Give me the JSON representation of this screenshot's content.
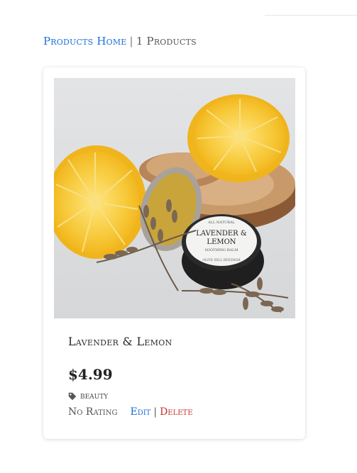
{
  "breadcrumb": {
    "home_link": "Products Home",
    "separator": "|",
    "count_text": "1 Products"
  },
  "product": {
    "image_label_line1": "LAVENDER &",
    "image_label_line2": "LEMON",
    "image_label_top": "ALL NATURAL",
    "image_label_sub": "SOOTHING BALM",
    "image_label_bottom": "OLIVE HILL BEESWAX",
    "title": "Lavender & Lemon",
    "price": "$4.99",
    "category_icon": "tag-icon",
    "category": "beauty",
    "rating": "No Rating",
    "edit_label": "Edit",
    "action_separator": "|",
    "delete_label": "Delete"
  },
  "colors": {
    "link": "#1a6fd6",
    "delete": "#c9302c",
    "text": "#2a2a2a"
  }
}
